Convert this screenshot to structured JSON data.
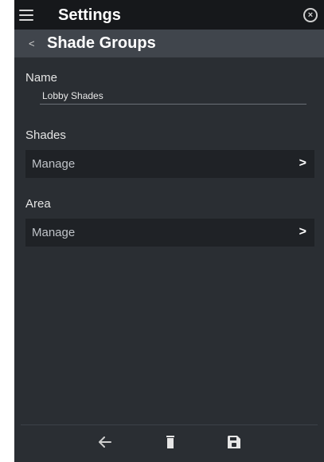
{
  "header": {
    "title": "Settings"
  },
  "subheader": {
    "title": "Shade Groups"
  },
  "form": {
    "name_label": "Name",
    "name_value": "Lobby Shades",
    "shades_label": "Shades",
    "shades_manage": "Manage",
    "area_label": "Area",
    "area_manage": "Manage"
  },
  "icons": {
    "menu": "hamburger-icon",
    "close": "close-circle-icon",
    "back": "chevron-left-icon",
    "chevron": "chevron-right-icon",
    "footer_back": "arrow-left-icon",
    "footer_delete": "trash-icon",
    "footer_save": "floppy-disk-icon"
  },
  "colors": {
    "topbar": "#16181b",
    "subbar": "#40454c",
    "background": "#2a2e33",
    "row": "#1f2226"
  }
}
